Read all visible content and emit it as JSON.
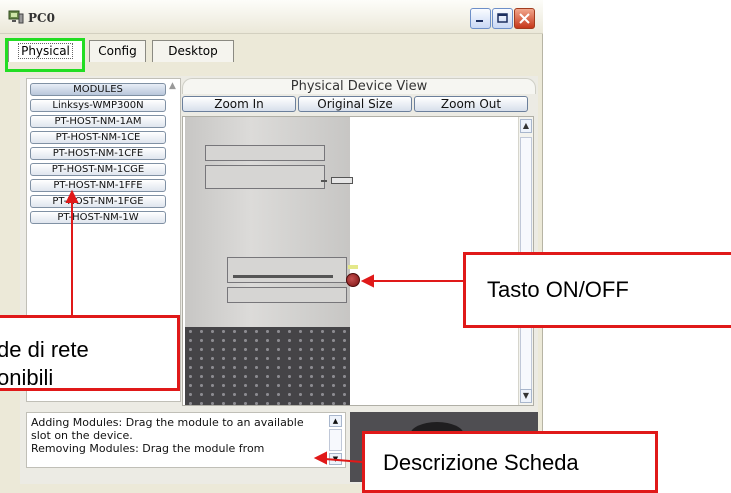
{
  "window": {
    "title": "PC0",
    "buttons": {
      "minimize": "minimize",
      "maximize": "maximize",
      "close": "close"
    }
  },
  "tabs": [
    {
      "label": "Physical",
      "active": true
    },
    {
      "label": "Config",
      "active": false
    },
    {
      "label": "Desktop",
      "active": false
    }
  ],
  "modules": {
    "header": "MODULES",
    "items": [
      "Linksys-WMP300N",
      "PT-HOST-NM-1AM",
      "PT-HOST-NM-1CE",
      "PT-HOST-NM-1CFE",
      "PT-HOST-NM-1CGE",
      "PT-HOST-NM-1FFE",
      "PT-HOST-NM-1FGE",
      "PT-HOST-NM-1W"
    ]
  },
  "physical_view": {
    "title": "Physical Device View",
    "zoom_in": "Zoom In",
    "original_size": "Original Size",
    "zoom_out": "Zoom Out"
  },
  "description": {
    "text": "Adding Modules: Drag the module to an available slot on the device.\nRemoving Modules: Drag the module from"
  },
  "annotations": {
    "cards_line1": "de di rete",
    "cards_line2": "onibili",
    "power": "Tasto ON/OFF",
    "card_description": "Descrizione Scheda"
  },
  "colors": {
    "highlight_green": "#22dd22",
    "annotation_red": "#e01919"
  }
}
